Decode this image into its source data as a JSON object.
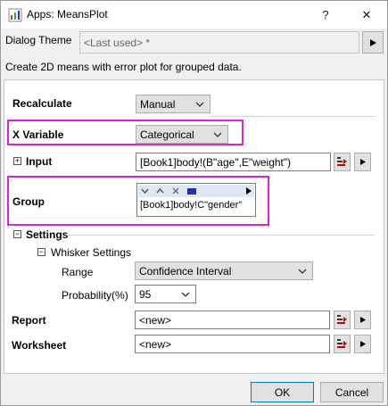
{
  "window": {
    "title": "Apps: MeansPlot",
    "help_label": "?",
    "close_label": "✕"
  },
  "theme": {
    "label": "Dialog Theme",
    "value": "<Last used> *"
  },
  "description": "Create 2D means with error plot for grouped data.",
  "form": {
    "recalculate": {
      "label": "Recalculate",
      "value": "Manual"
    },
    "x_variable": {
      "label": "X Variable",
      "value": "Categorical"
    },
    "input": {
      "label": "Input",
      "value": "[Book1]body!(B\"age\",E\"weight\")"
    },
    "group": {
      "label": "Group",
      "value": "[Book1]body!C\"gender\""
    },
    "settings": {
      "label": "Settings"
    },
    "whisker": {
      "label": "Whisker Settings"
    },
    "range": {
      "label": "Range",
      "value": "Confidence Interval"
    },
    "probability": {
      "label": "Probability(%)",
      "value": "95"
    },
    "report": {
      "label": "Report",
      "value": "<new>"
    },
    "worksheet": {
      "label": "Worksheet",
      "value": "<new>"
    }
  },
  "buttons": {
    "ok": "OK",
    "cancel": "Cancel"
  },
  "colors": {
    "highlight": "#e020e0",
    "accent": "#0078d7"
  }
}
